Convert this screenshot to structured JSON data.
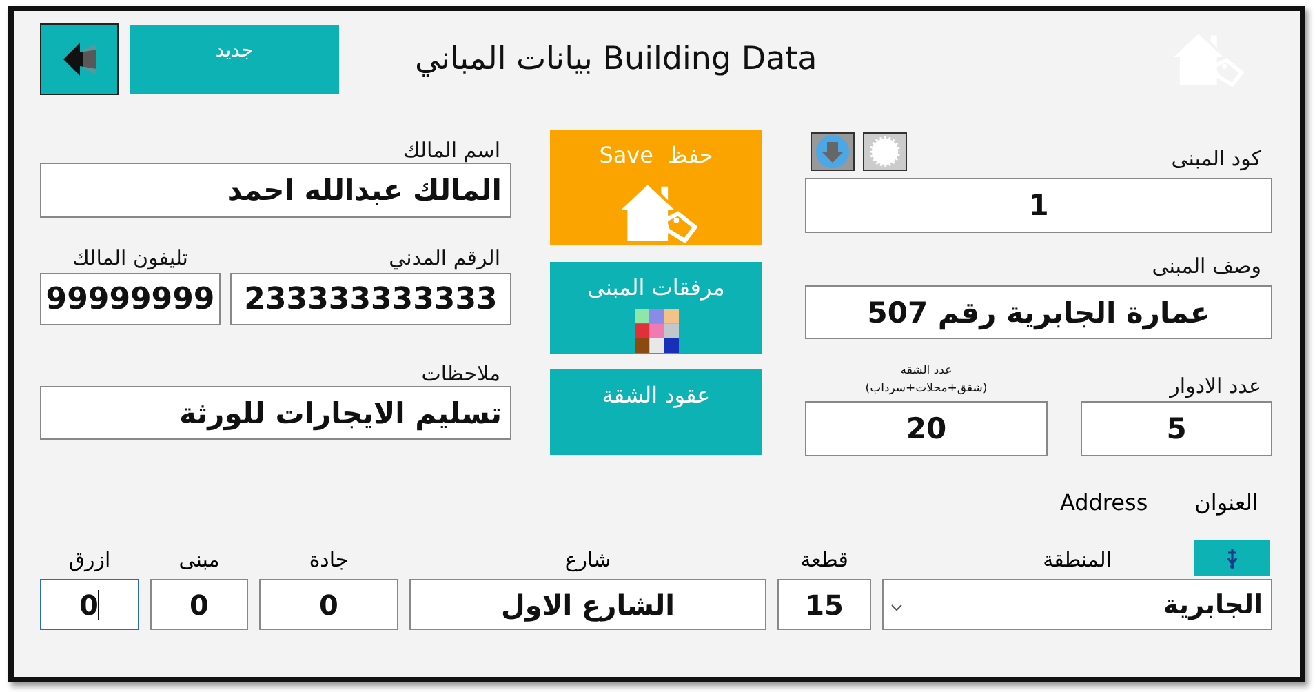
{
  "window": {
    "title": "بيانات المباني Building Data"
  },
  "toolbar": {
    "new_button": "جديد"
  },
  "actions": [
    {
      "kind": "save",
      "label": "Save  حفظ"
    },
    {
      "kind": "attachments",
      "label": "مرفقات المبنى"
    },
    {
      "kind": "contracts",
      "label": "عقود الشقة"
    }
  ],
  "building": {
    "code": {
      "label": "كود المبنى",
      "value": "1"
    },
    "description": {
      "label": "وصف المبنى",
      "value": "عمارة الجابرية رقم 507"
    },
    "floors": {
      "label": "عدد الادوار",
      "value": "5"
    },
    "units": {
      "label": "عدد الشقه",
      "note": "(شقق+محلات+سرداب)",
      "value": "20"
    }
  },
  "owner": {
    "name": {
      "label": "اسم المالك",
      "value": "المالك عبدالله احمد"
    },
    "civil_id": {
      "label": "الرقم المدني",
      "value": "233333333333"
    },
    "phone": {
      "label": "تليفون المالك",
      "value": "99999999"
    },
    "notes": {
      "label": "ملاحظات",
      "value": "تسليم الايجارات للورثة"
    }
  },
  "address": {
    "label": "العنوان",
    "label_en": "Address",
    "fields": [
      {
        "kind": "dropdown",
        "label": "المنطقة",
        "value": "الجابرية",
        "focused": false
      },
      {
        "kind": "text",
        "label": "قطعة",
        "value": "15",
        "focused": false
      },
      {
        "kind": "text",
        "label": "شارع",
        "value": "الشارع الاول",
        "focused": false
      },
      {
        "kind": "text",
        "label": "جادة",
        "value": "0",
        "focused": false
      },
      {
        "kind": "text",
        "label": "مبنى",
        "value": "0",
        "focused": false
      },
      {
        "kind": "text",
        "label": "ازرق",
        "value": "0",
        "focused": true
      }
    ]
  }
}
